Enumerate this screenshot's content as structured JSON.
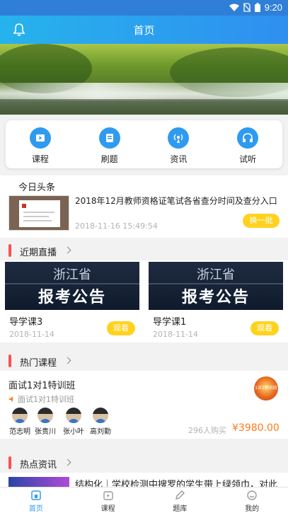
{
  "status_bar": {
    "time": "9:20"
  },
  "header": {
    "title": "首页"
  },
  "quick_nav": [
    {
      "label": "课程",
      "icon": "play-video-icon"
    },
    {
      "label": "刷题",
      "icon": "document-icon"
    },
    {
      "label": "资讯",
      "icon": "broadcast-icon"
    },
    {
      "label": "试听",
      "icon": "headphones-icon"
    }
  ],
  "headlines": {
    "heading": "今日头条",
    "title": "2018年12月教师资格证笔试各省查分时间及查分入口",
    "time": "2018-11-16 15:49:54",
    "refresh_label": "换一批"
  },
  "live": {
    "heading": "近期直播",
    "cards": [
      {
        "thumb_line1": "浙江省",
        "thumb_line2": "报考公告",
        "name": "导学课3",
        "date": "2018-11-14",
        "watch_label": "观看"
      },
      {
        "thumb_line1": "浙江省",
        "thumb_line2": "报考公告",
        "name": "导学课1",
        "date": "2018-11-14",
        "watch_label": "观看"
      }
    ]
  },
  "hot_courses": {
    "heading": "热门课程",
    "course": {
      "title": "面试1对1特训班",
      "subtitle": "面试1对1特训班",
      "badge": "1对1特训班",
      "teachers": [
        "范志明",
        "张贵川",
        "张小叶",
        "高刘勤"
      ],
      "buy_count": "296人购买",
      "price": "¥3980.00"
    }
  },
  "hot_info": {
    "heading": "热点资讯",
    "title": "结构化｜学校检测中搜罗的学生带上绿领巾，对此"
  },
  "tabbar": [
    {
      "label": "首页",
      "icon": "home-icon",
      "active": true
    },
    {
      "label": "课程",
      "icon": "course-icon",
      "active": false
    },
    {
      "label": "题库",
      "icon": "pencil-icon",
      "active": false
    },
    {
      "label": "我的",
      "icon": "profile-icon",
      "active": false
    }
  ],
  "colors": {
    "accent": "#2f9bf0",
    "header_start": "#26b3ec",
    "header_end": "#2f8ff0",
    "button_yellow": "#ffd21f",
    "section_mark": "#ff4f4f",
    "price": "#ff7a1a"
  }
}
